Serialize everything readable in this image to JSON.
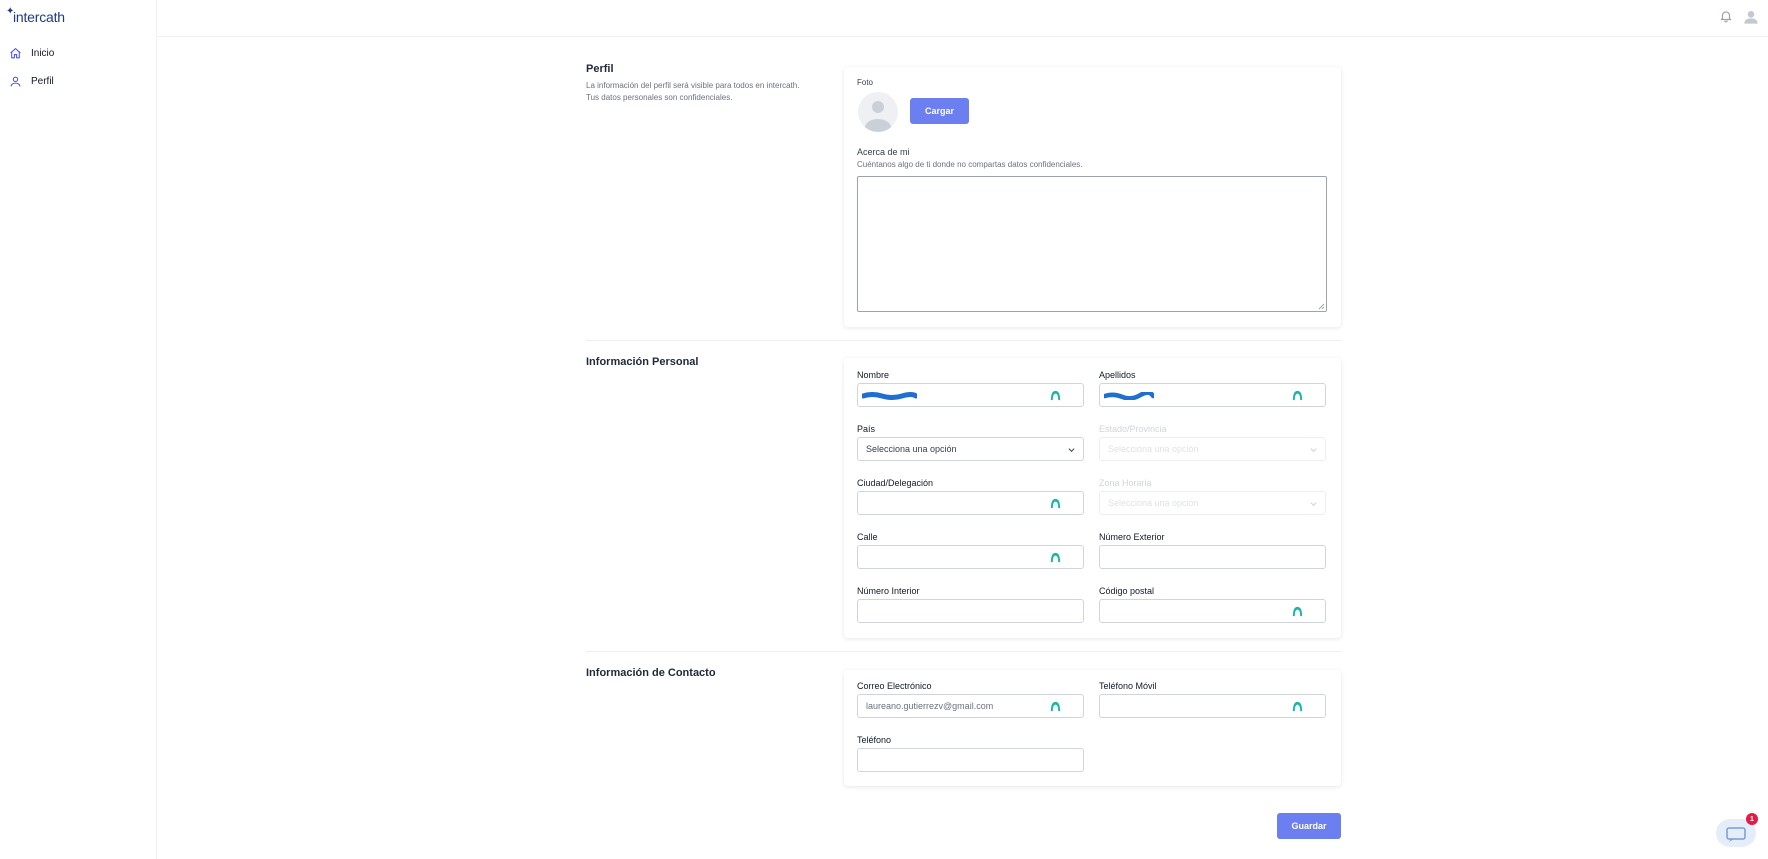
{
  "brand": {
    "logo_text": "intercath"
  },
  "sidebar": {
    "items": [
      {
        "label": "Inicio",
        "icon": "home-icon"
      },
      {
        "label": "Perfil",
        "icon": "user-icon"
      }
    ]
  },
  "profile": {
    "title": "Perfil",
    "description_1": "La información del perfil será visible para todos en intercath.",
    "description_2": "Tus datos personales son confidenciales.",
    "photo_label": "Foto",
    "upload_label": "Cargar",
    "about_label": "Acerca de mi",
    "about_help": "Cuéntanos algo de ti donde no compartas datos confidenciales."
  },
  "personal": {
    "title": "Información Personal",
    "nombre_label": "Nombre",
    "apellidos_label": "Apellidos",
    "pais_label": "País",
    "pais_value": "Selecciona una opción",
    "estado_label": "Estado/Provincia",
    "estado_value": "Selecciona una opción",
    "ciudad_label": "Ciudad/Delegación",
    "zona_label": "Zona Horaria",
    "zona_value": "Selecciona una opción",
    "calle_label": "Calle",
    "num_ext_label": "Número Exterior",
    "num_int_label": "Número Interior",
    "cp_label": "Código postal"
  },
  "contact": {
    "title": "Información de Contacto",
    "email_label": "Correo Electrónico",
    "email_value": "laureano.gutierrezv@gmail.com",
    "movil_label": "Teléfono Móvil",
    "telefono_label": "Teléfono"
  },
  "actions": {
    "save_label": "Guardar"
  },
  "chat": {
    "badge": "1"
  },
  "colors": {
    "accent": "#6b7ff0",
    "ai_icon": "#14b8a6",
    "redacted": "#1f6fd1",
    "badge": "#e11d48"
  }
}
